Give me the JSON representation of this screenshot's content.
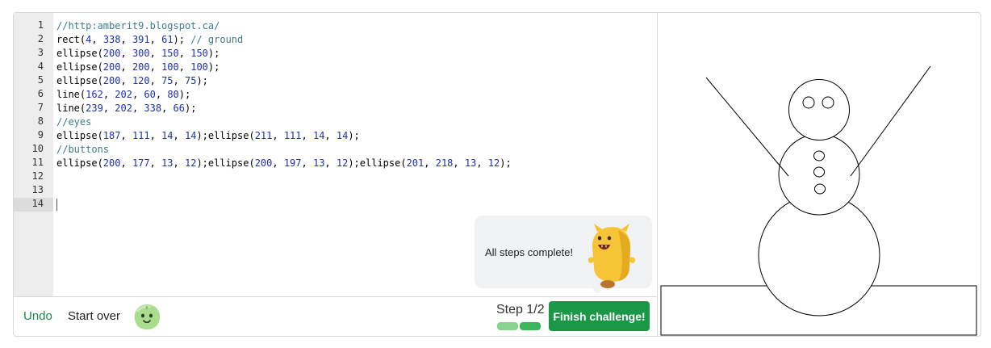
{
  "editor": {
    "line_numbers": [
      "1",
      "2",
      "3",
      "4",
      "5",
      "6",
      "7",
      "8",
      "9",
      "10",
      "11",
      "12",
      "13",
      "14"
    ],
    "active_line": 14,
    "lines": [
      [
        {
          "t": "//http:amberit9.blogspot.ca/",
          "k": "c"
        }
      ],
      [
        {
          "t": "rect(",
          "k": ""
        },
        {
          "t": "4",
          "k": "n"
        },
        {
          "t": ", ",
          "k": ""
        },
        {
          "t": "338",
          "k": "n"
        },
        {
          "t": ", ",
          "k": ""
        },
        {
          "t": "391",
          "k": "n"
        },
        {
          "t": ", ",
          "k": ""
        },
        {
          "t": "61",
          "k": "n"
        },
        {
          "t": "); ",
          "k": ""
        },
        {
          "t": "// ground",
          "k": "c"
        }
      ],
      [
        {
          "t": "ellipse(",
          "k": ""
        },
        {
          "t": "200",
          "k": "n"
        },
        {
          "t": ", ",
          "k": ""
        },
        {
          "t": "300",
          "k": "n"
        },
        {
          "t": ", ",
          "k": ""
        },
        {
          "t": "150",
          "k": "n"
        },
        {
          "t": ", ",
          "k": ""
        },
        {
          "t": "150",
          "k": "n"
        },
        {
          "t": ");",
          "k": ""
        }
      ],
      [
        {
          "t": "ellipse(",
          "k": ""
        },
        {
          "t": "200",
          "k": "n"
        },
        {
          "t": ", ",
          "k": ""
        },
        {
          "t": "200",
          "k": "n"
        },
        {
          "t": ", ",
          "k": ""
        },
        {
          "t": "100",
          "k": "n"
        },
        {
          "t": ", ",
          "k": ""
        },
        {
          "t": "100",
          "k": "n"
        },
        {
          "t": ");",
          "k": ""
        }
      ],
      [
        {
          "t": "ellipse(",
          "k": ""
        },
        {
          "t": "200",
          "k": "n"
        },
        {
          "t": ", ",
          "k": ""
        },
        {
          "t": "120",
          "k": "n"
        },
        {
          "t": ", ",
          "k": ""
        },
        {
          "t": "75",
          "k": "n"
        },
        {
          "t": ", ",
          "k": ""
        },
        {
          "t": "75",
          "k": "n"
        },
        {
          "t": ");",
          "k": ""
        }
      ],
      [
        {
          "t": "line(",
          "k": ""
        },
        {
          "t": "162",
          "k": "n"
        },
        {
          "t": ", ",
          "k": ""
        },
        {
          "t": "202",
          "k": "n"
        },
        {
          "t": ", ",
          "k": ""
        },
        {
          "t": "60",
          "k": "n"
        },
        {
          "t": ", ",
          "k": ""
        },
        {
          "t": "80",
          "k": "n"
        },
        {
          "t": ");",
          "k": ""
        }
      ],
      [
        {
          "t": "line(",
          "k": ""
        },
        {
          "t": "239",
          "k": "n"
        },
        {
          "t": ", ",
          "k": ""
        },
        {
          "t": "202",
          "k": "n"
        },
        {
          "t": ", ",
          "k": ""
        },
        {
          "t": "338",
          "k": "n"
        },
        {
          "t": ", ",
          "k": ""
        },
        {
          "t": "66",
          "k": "n"
        },
        {
          "t": ");",
          "k": ""
        }
      ],
      [
        {
          "t": "//eyes",
          "k": "c"
        }
      ],
      [
        {
          "t": "ellipse(",
          "k": ""
        },
        {
          "t": "187",
          "k": "n"
        },
        {
          "t": ", ",
          "k": ""
        },
        {
          "t": "111",
          "k": "n"
        },
        {
          "t": ", ",
          "k": ""
        },
        {
          "t": "14",
          "k": "n"
        },
        {
          "t": ", ",
          "k": ""
        },
        {
          "t": "14",
          "k": "n"
        },
        {
          "t": ");ellipse(",
          "k": ""
        },
        {
          "t": "211",
          "k": "n"
        },
        {
          "t": ", ",
          "k": ""
        },
        {
          "t": "111",
          "k": "n"
        },
        {
          "t": ", ",
          "k": ""
        },
        {
          "t": "14",
          "k": "n"
        },
        {
          "t": ", ",
          "k": ""
        },
        {
          "t": "14",
          "k": "n"
        },
        {
          "t": ");",
          "k": ""
        }
      ],
      [
        {
          "t": "//buttons",
          "k": "c"
        }
      ],
      [
        {
          "t": "ellipse(",
          "k": ""
        },
        {
          "t": "200",
          "k": "n"
        },
        {
          "t": ", ",
          "k": ""
        },
        {
          "t": "177",
          "k": "n"
        },
        {
          "t": ", ",
          "k": ""
        },
        {
          "t": "13",
          "k": "n"
        },
        {
          "t": ", ",
          "k": ""
        },
        {
          "t": "12",
          "k": "n"
        },
        {
          "t": ");ellipse(",
          "k": ""
        },
        {
          "t": "200",
          "k": "n"
        },
        {
          "t": ", ",
          "k": ""
        },
        {
          "t": "197",
          "k": "n"
        },
        {
          "t": ", ",
          "k": ""
        },
        {
          "t": "13",
          "k": "n"
        },
        {
          "t": ", ",
          "k": ""
        },
        {
          "t": "12",
          "k": "n"
        },
        {
          "t": ");ellipse(",
          "k": ""
        },
        {
          "t": "201",
          "k": "n"
        },
        {
          "t": ", ",
          "k": ""
        },
        {
          "t": "218",
          "k": "n"
        },
        {
          "t": ", ",
          "k": ""
        },
        {
          "t": "13",
          "k": "n"
        },
        {
          "t": ", ",
          "k": ""
        },
        {
          "t": "12",
          "k": "n"
        },
        {
          "t": ");",
          "k": ""
        }
      ],
      [],
      [],
      []
    ]
  },
  "toolbar": {
    "undo_label": "Undo",
    "start_over_label": "Start over",
    "step_label": "Step 1/2",
    "finish_label": "Finish challenge!",
    "steps_total": 2,
    "steps_done": 2
  },
  "bubble": {
    "message": "All steps complete!"
  },
  "colors": {
    "accent_green": "#1a9848",
    "link_green": "#1a8a4b",
    "progress_green": "#3cb65a",
    "progress_light": "#8ad28f",
    "comment": "#3e7c8a",
    "number": "#1f2fb0",
    "gutter_bg": "#ededed",
    "bubble_bg": "#f0f2f4"
  },
  "icons": {
    "small_avatar": "green-blob-avatar-icon",
    "mascot": "yellow-monster-mascot-icon"
  }
}
